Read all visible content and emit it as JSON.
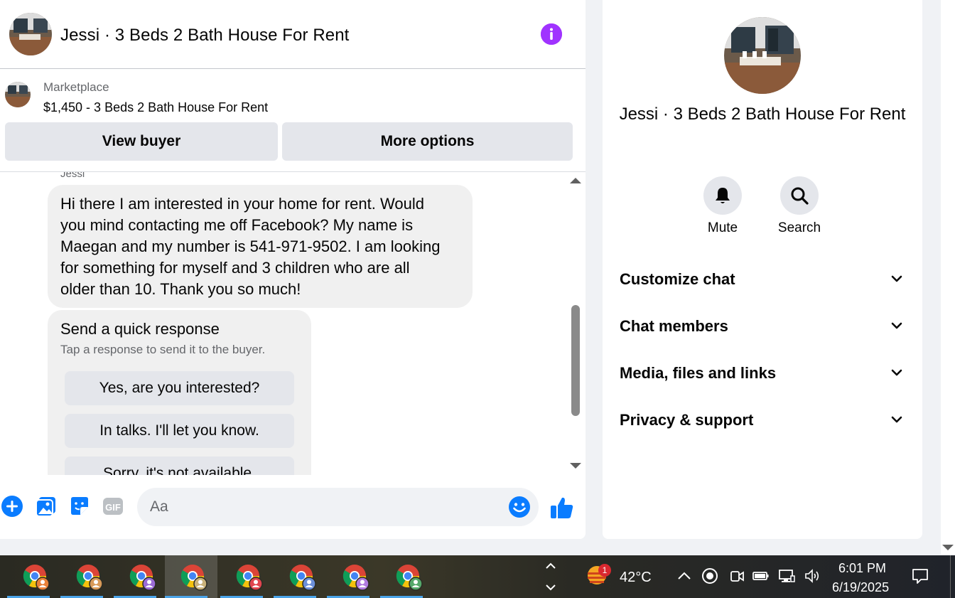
{
  "chat": {
    "header_title": "Jessi · 3 Beds 2 Bath House For Rent",
    "marketplace_label": "Marketplace",
    "listing": "$1,450 - 3 Beds 2 Bath House For Rent",
    "view_buyer_label": "View buyer",
    "more_options_label": "More options",
    "sender_name": "Jessi",
    "message_lines": [
      "Hi there I am interested in your home for rent.  Would",
      "you mind contacting me off Facebook?  My name is",
      "Maegan and my number is 541-971-9502.  I am looking",
      "for something for myself and 3 children who are all",
      "older than 10.  Thank you so much!"
    ],
    "quick_response": {
      "title": "Send a quick response",
      "subtitle": "Tap a response to send it to the buyer.",
      "options": [
        "Yes, are you interested?",
        "In talks. I'll let you know.",
        "Sorry, it's not available."
      ]
    },
    "composer_placeholder": "Aa",
    "accent_color": "#0a7cff",
    "info_color": "#a033ff"
  },
  "info_panel": {
    "title": "Jessi · 3 Beds 2 Bath House For Rent",
    "mute_label": "Mute",
    "search_label": "Search",
    "sections": [
      "Customize chat",
      "Chat members",
      "Media, files and links",
      "Privacy & support"
    ]
  },
  "taskbar": {
    "apps": [
      "chrome-profile-orange",
      "chrome-profile-orange",
      "chrome-profile-purple",
      "chrome-profile-tan",
      "chrome-profile-red",
      "chrome-profile-blue",
      "chrome-profile-purple",
      "chrome-profile-green"
    ],
    "weather_badge": "1",
    "temperature": "42°C",
    "time": "6:01 PM",
    "date": "6/19/2025"
  }
}
